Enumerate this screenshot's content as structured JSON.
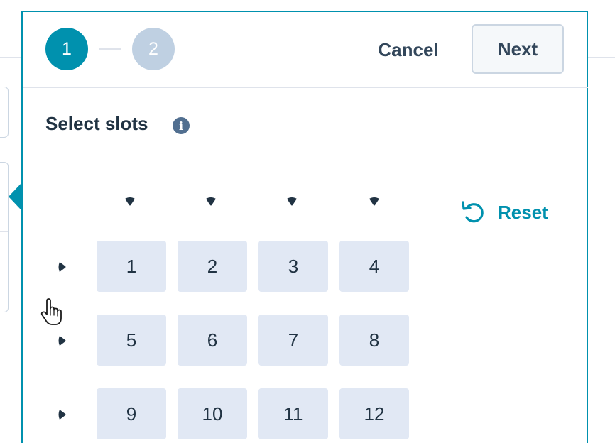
{
  "steps": [
    {
      "number": "1",
      "state": "active",
      "color": "#0091ae"
    },
    {
      "number": "2",
      "state": "inactive",
      "color": "#bfd0e2"
    }
  ],
  "header": {
    "cancel_label": "Cancel",
    "next_label": "Next"
  },
  "section": {
    "title": "Select slots",
    "info_icon": "info-icon",
    "info_glyph": "i"
  },
  "reset": {
    "label": "Reset",
    "icon": "reset-icon",
    "color": "#0091ae"
  },
  "grid": {
    "column_selectors": 4,
    "rows": [
      [
        "1",
        "2",
        "3",
        "4"
      ],
      [
        "5",
        "6",
        "7",
        "8"
      ],
      [
        "9",
        "10",
        "11",
        "12"
      ]
    ]
  },
  "colors": {
    "accent": "#0091ae",
    "slot_background": "#e1e8f4",
    "text_dark": "#213343"
  }
}
